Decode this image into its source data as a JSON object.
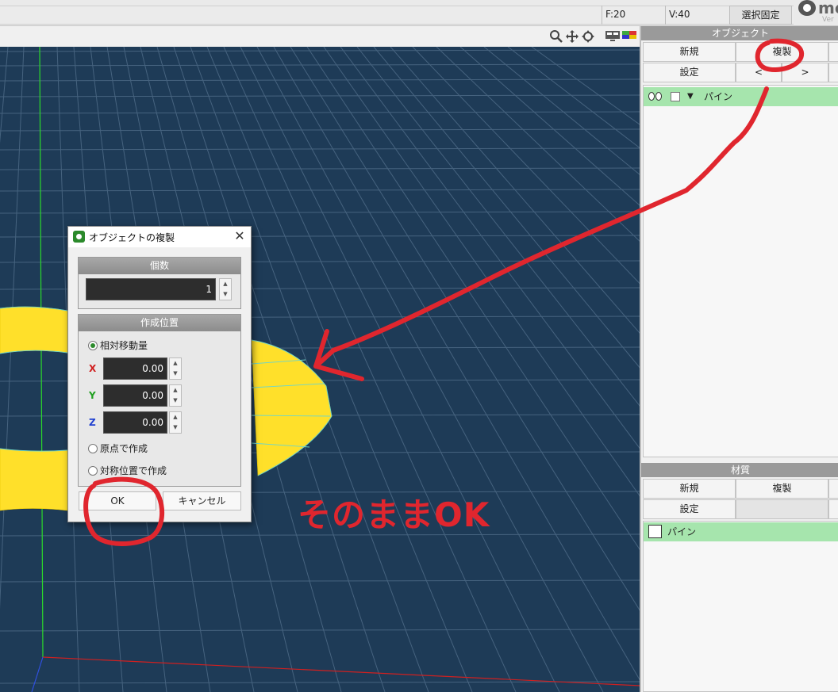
{
  "status": {
    "faces": "F:20",
    "vertices": "V:40",
    "select_lock": "選択固定"
  },
  "logo": {
    "name": "me",
    "version": "Ver"
  },
  "view_tools": [
    "zoom-icon",
    "move-icon",
    "rotate-icon",
    "screen-icon",
    "palette-icon"
  ],
  "object_panel": {
    "title": "オブジェクト",
    "buttons": {
      "new": "新規",
      "duplicate": "複製",
      "settings": "設定",
      "prev": "<",
      "next": ">"
    },
    "items": [
      {
        "name": "パイン"
      }
    ]
  },
  "material_panel": {
    "title": "材質",
    "buttons": {
      "new": "新規",
      "duplicate": "複製",
      "settings": "設定"
    },
    "items": [
      {
        "name": "パイン"
      }
    ]
  },
  "dialog": {
    "title": "オブジェクトの複製",
    "count_label": "個数",
    "count_value": "1",
    "position_label": "作成位置",
    "options": {
      "relative": "相対移動量",
      "origin": "原点で作成",
      "symmetric": "対称位置で作成"
    },
    "axes": [
      {
        "label": "X",
        "value": "0.00",
        "color": "#d02020"
      },
      {
        "label": "Y",
        "value": "0.00",
        "color": "#20a020"
      },
      {
        "label": "Z",
        "value": "0.00",
        "color": "#2040d0"
      }
    ],
    "ok": "OK",
    "cancel": "キャンセル"
  },
  "annotation": {
    "text": "そのままOK",
    "color": "#e0262e"
  },
  "colors": {
    "viewport_bg": "#1e3b57",
    "mesh": "#ffe02a",
    "selection_green": "#a6e5ad"
  }
}
